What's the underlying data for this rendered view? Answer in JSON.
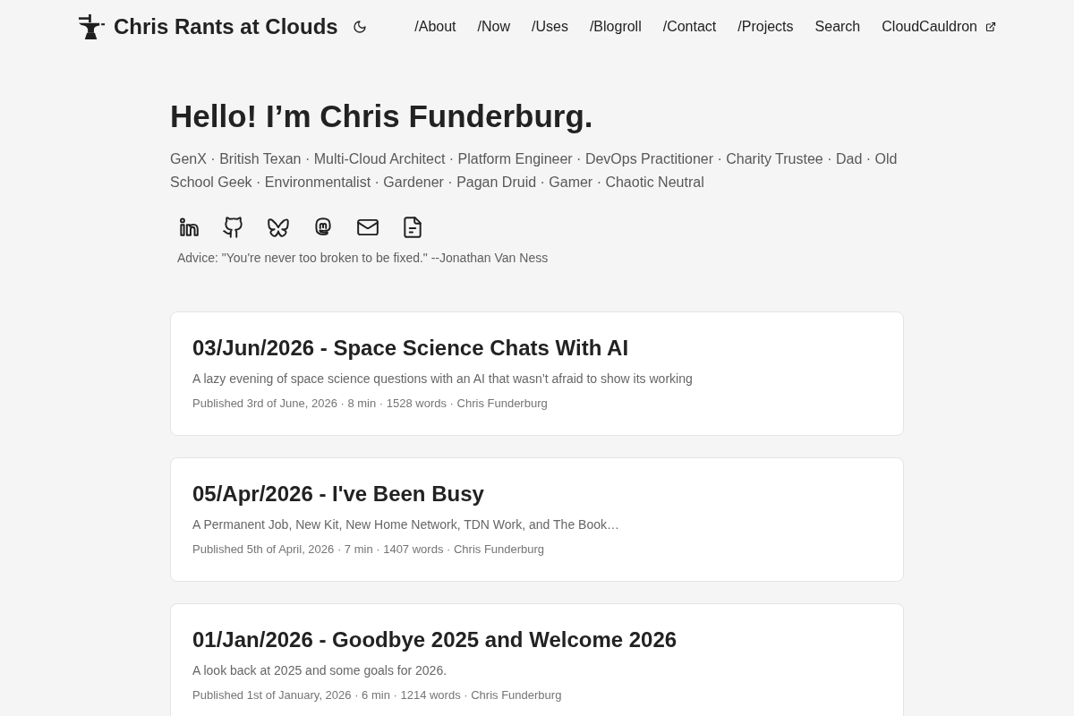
{
  "header": {
    "site_title": "Chris Rants at Clouds",
    "nav": [
      {
        "label": "/About",
        "external": false
      },
      {
        "label": "/Now",
        "external": false
      },
      {
        "label": "/Uses",
        "external": false
      },
      {
        "label": "/Blogroll",
        "external": false
      },
      {
        "label": "/Contact",
        "external": false
      },
      {
        "label": "/Projects",
        "external": false
      },
      {
        "label": "Search",
        "external": false
      },
      {
        "label": "CloudCauldron",
        "external": true
      }
    ]
  },
  "intro": {
    "heading": "Hello! I’m Chris Funderburg.",
    "tagline": "GenX · British Texan · Multi-Cloud Architect · Platform Engineer · DevOps Practitioner · Charity Trustee · Dad · Old School Geek · Environmentalist · Gardener · Pagan Druid · Gamer · Chaotic Neutral",
    "advice": "Advice: \"You're never too broken to be fixed.\" --Jonathan Van Ness"
  },
  "posts": [
    {
      "title": "03/Jun/2026 - Space Science Chats With AI",
      "summary": "A lazy evening of space science questions with an AI that wasn’t afraid to show its working",
      "meta": "Published 3rd of June, 2026 · 8 min · 1528 words · Chris Funderburg"
    },
    {
      "title": "05/Apr/2026 - I've Been Busy",
      "summary": "A Permanent Job, New Kit, New Home Network, TDN Work, and The Book…",
      "meta": "Published 5th of April, 2026 · 7 min · 1407 words · Chris Funderburg"
    },
    {
      "title": "01/Jan/2026 - Goodbye 2025 and Welcome 2026",
      "summary": "A look back at 2025 and some goals for 2026.",
      "meta": "Published 1st of January, 2026 · 6 min · 1214 words · Chris Funderburg"
    }
  ]
}
